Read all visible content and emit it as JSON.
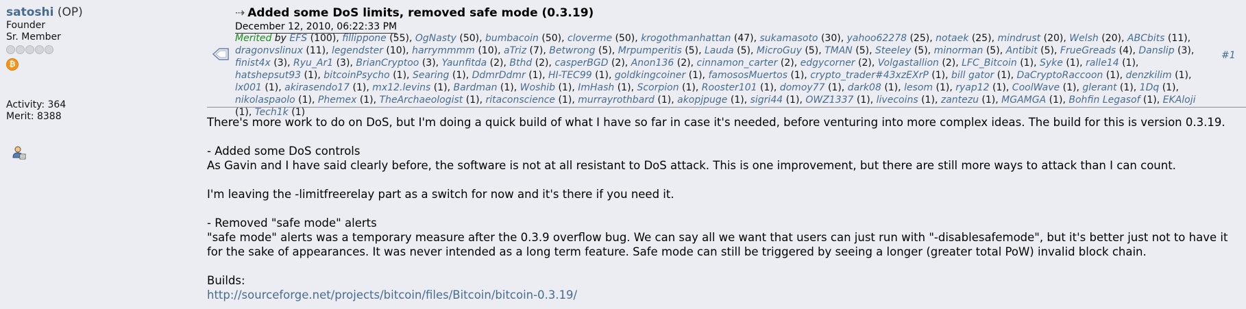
{
  "poster": {
    "name": "satoshi",
    "op_tag": "(OP)",
    "rank1": "Founder",
    "rank2": "Sr. Member",
    "activity": "Activity: 364",
    "merit": "Merit: 8388"
  },
  "post": {
    "title": "Added some DoS limits, removed safe mode (0.3.19)",
    "date": "December 12, 2010, 06:22:33 PM",
    "number": "#1",
    "merited_label": "Merited",
    "merited_by": "by",
    "merits": [
      {
        "user": "EFS",
        "count": "(100)"
      },
      {
        "user": "fillippone",
        "count": "(55)"
      },
      {
        "user": "OgNasty",
        "count": "(50)"
      },
      {
        "user": "bumbacoin",
        "count": "(50)"
      },
      {
        "user": "cloverme",
        "count": "(50)"
      },
      {
        "user": "krogothmanhattan",
        "count": "(47)"
      },
      {
        "user": "sukamasoto",
        "count": "(30)"
      },
      {
        "user": "yahoo62278",
        "count": "(25)"
      },
      {
        "user": "notaek",
        "count": "(25)"
      },
      {
        "user": "mindrust",
        "count": "(20)"
      },
      {
        "user": "Welsh",
        "count": "(20)"
      },
      {
        "user": "ABCbits",
        "count": "(11)"
      },
      {
        "user": "dragonvslinux",
        "count": "(11)"
      },
      {
        "user": "legendster",
        "count": "(10)"
      },
      {
        "user": "harrymmmm",
        "count": "(10)"
      },
      {
        "user": "aTriz",
        "count": "(7)"
      },
      {
        "user": "Betwrong",
        "count": "(5)"
      },
      {
        "user": "Mrpumperitis",
        "count": "(5)"
      },
      {
        "user": "Lauda",
        "count": "(5)"
      },
      {
        "user": "MicroGuy",
        "count": "(5)"
      },
      {
        "user": "TMAN",
        "count": "(5)"
      },
      {
        "user": "Steeley",
        "count": "(5)"
      },
      {
        "user": "minorman",
        "count": "(5)"
      },
      {
        "user": "Antibit",
        "count": "(5)"
      },
      {
        "user": "FrueGreads",
        "count": "(4)"
      },
      {
        "user": "Danslip",
        "count": "(3)"
      },
      {
        "user": "finist4x",
        "count": "(3)"
      },
      {
        "user": "Ryu_Ar1",
        "count": "(3)"
      },
      {
        "user": "BrianCryptoo",
        "count": "(3)"
      },
      {
        "user": "Yaunfitda",
        "count": "(2)"
      },
      {
        "user": "Bthd",
        "count": "(2)"
      },
      {
        "user": "casperBGD",
        "count": "(2)"
      },
      {
        "user": "Anon136",
        "count": "(2)"
      },
      {
        "user": "cinnamon_carter",
        "count": "(2)"
      },
      {
        "user": "edgycorner",
        "count": "(2)"
      },
      {
        "user": "Volgastallion",
        "count": "(2)"
      },
      {
        "user": "LFC_Bitcoin",
        "count": "(1)"
      },
      {
        "user": "Syke",
        "count": "(1)"
      },
      {
        "user": "ralle14",
        "count": "(1)"
      },
      {
        "user": "hatshepsut93",
        "count": "(1)"
      },
      {
        "user": "bitcoinPsycho",
        "count": "(1)"
      },
      {
        "user": "Searing",
        "count": "(1)"
      },
      {
        "user": "DdmrDdmr",
        "count": "(1)"
      },
      {
        "user": "HI-TEC99",
        "count": "(1)"
      },
      {
        "user": "goldkingcoiner",
        "count": "(1)"
      },
      {
        "user": "famososMuertos",
        "count": "(1)"
      },
      {
        "user": "crypto_trader#43xzEXrP",
        "count": "(1)"
      },
      {
        "user": "bill gator",
        "count": "(1)"
      },
      {
        "user": "DaCryptoRaccoon",
        "count": "(1)"
      },
      {
        "user": "denzkilim",
        "count": "(1)"
      },
      {
        "user": "lx001",
        "count": "(1)"
      },
      {
        "user": "akirasendo17",
        "count": "(1)"
      },
      {
        "user": "mx12.levins",
        "count": "(1)"
      },
      {
        "user": "Bardman",
        "count": "(1)"
      },
      {
        "user": "Woshib",
        "count": "(1)"
      },
      {
        "user": "ImHash",
        "count": "(1)"
      },
      {
        "user": "Scorpion",
        "count": "(1)"
      },
      {
        "user": "Rooster101",
        "count": "(1)"
      },
      {
        "user": "domoy77",
        "count": "(1)"
      },
      {
        "user": "dark08",
        "count": "(1)"
      },
      {
        "user": "lesom",
        "count": "(1)"
      },
      {
        "user": "ryap12",
        "count": "(1)"
      },
      {
        "user": "CoolWave",
        "count": "(1)"
      },
      {
        "user": "glerant",
        "count": "(1)"
      },
      {
        "user": "1Dq",
        "count": "(1)"
      },
      {
        "user": "nikolaspaolo",
        "count": "(1)"
      },
      {
        "user": "Phemex",
        "count": "(1)"
      },
      {
        "user": "TheArchaeologist",
        "count": "(1)"
      },
      {
        "user": "ritaconscience",
        "count": "(1)"
      },
      {
        "user": "murrayrothbard",
        "count": "(1)"
      },
      {
        "user": "akopjpuge",
        "count": "(1)"
      },
      {
        "user": "sigri44",
        "count": "(1)"
      },
      {
        "user": "OWZ1337",
        "count": "(1)"
      },
      {
        "user": "livecoins",
        "count": "(1)"
      },
      {
        "user": "zantezu",
        "count": "(1)"
      },
      {
        "user": "MGAMGA",
        "count": "(1)"
      },
      {
        "user": "Bohfin Legasof",
        "count": "(1)"
      },
      {
        "user": "EKAloji",
        "count": "(1)"
      },
      {
        "user": "Tech1k",
        "count": "(1)"
      }
    ],
    "body": {
      "p1": "There's more work to do on DoS, but I'm doing a quick build of what I have so far in case it's needed, before venturing into more complex ideas.  The build for this is version 0.3.19.",
      "h1": "- Added some DoS controls",
      "p2": "As Gavin and I have said clearly before, the software is not at all resistant to DoS attack.  This is one improvement, but there are still more ways to attack than I can count.",
      "p3": "I'm leaving the -limitfreerelay part as a switch for now and it's there if you need it.",
      "h2": "- Removed \"safe mode\" alerts",
      "p4": "\"safe mode\" alerts was a temporary measure after the 0.3.9 overflow bug.  We can say all we want that users can just run with \"-disablesafemode\", but it's better just not to have it for the sake of appearances.  It was never intended as a long term feature.  Safe mode can still be triggered by seeing a longer (greater total PoW) invalid block chain.",
      "builds_label": "Builds:",
      "builds_link": "http://sourceforge.net/projects/bitcoin/files/Bitcoin/bitcoin-0.3.19/"
    }
  },
  "icons": {
    "star": "star-icon",
    "coin": "bitcoin-coin-icon",
    "profile": "profile-icon",
    "topic": "topic-message-icon"
  },
  "colors": {
    "background": "#ECEDF3",
    "link": "#476C8E",
    "merited": "#1E8C1E",
    "coin": "#F7931A"
  }
}
